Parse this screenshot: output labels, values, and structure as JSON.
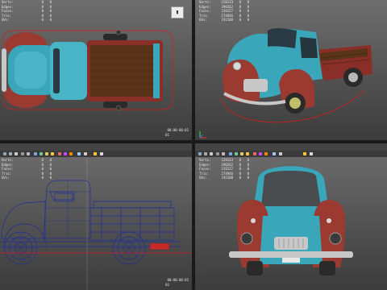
{
  "viewports": {
    "top": {
      "stats": [
        {
          "key": "Verts:",
          "value": "",
          "a": "0",
          "b": "0"
        },
        {
          "key": "Edges:",
          "value": "",
          "a": "0",
          "b": "0"
        },
        {
          "key": "Faces:",
          "value": "",
          "a": "0",
          "b": "0"
        },
        {
          "key": "Tris:",
          "value": "",
          "a": "0",
          "b": "0"
        },
        {
          "key": "UVs:",
          "value": "",
          "a": "0",
          "b": "0"
        }
      ],
      "corner_button_glyph": "▮",
      "time": "00:00:00:01",
      "frame": "01"
    },
    "perspective": {
      "stats": [
        {
          "key": "Verts:",
          "value": "158133",
          "a": "0",
          "b": "0"
        },
        {
          "key": "Edges:",
          "value": "290262",
          "a": "0",
          "b": "0"
        },
        {
          "key": "Faces:",
          "value": "150127",
          "a": "0",
          "b": "0"
        },
        {
          "key": "Tris:",
          "value": "274946",
          "a": "0",
          "b": "0"
        },
        {
          "key": "UVs:",
          "value": "192108",
          "a": "0",
          "b": "0"
        }
      ]
    },
    "side": {
      "menu": [
        "Lighting",
        "Show",
        "Renderer",
        "Panels"
      ],
      "stats": [
        {
          "key": "Verts:",
          "value": "",
          "a": "0",
          "b": "0"
        },
        {
          "key": "Edges:",
          "value": "",
          "a": "0",
          "b": "0"
        },
        {
          "key": "Faces:",
          "value": "",
          "a": "0",
          "b": "0"
        },
        {
          "key": "Tris:",
          "value": "",
          "a": "0",
          "b": "0"
        },
        {
          "key": "UVs:",
          "value": "",
          "a": "0",
          "b": "0"
        }
      ],
      "time": "00:00:00:01",
      "frame": "01"
    },
    "front": {
      "menu": [
        "View",
        "Shading",
        "Lighting",
        "Show",
        "Renderer",
        "Panels"
      ],
      "stats": [
        {
          "key": "Verts:",
          "value": "158133",
          "a": "0",
          "b": "0"
        },
        {
          "key": "Edges:",
          "value": "290262",
          "a": "0",
          "b": "0"
        },
        {
          "key": "Faces:",
          "value": "150127",
          "a": "0",
          "b": "0"
        },
        {
          "key": "Tris:",
          "value": "274946",
          "a": "0",
          "b": "0"
        },
        {
          "key": "UVs:",
          "value": "192108",
          "a": "0",
          "b": "0"
        }
      ]
    }
  },
  "colors": {
    "body_teal": "#3aa6b9",
    "fender_red": "#9b3a30",
    "wood": "#5a3418",
    "chrome": "#c8c8c8",
    "tire": "#2a2a2a",
    "wire_blue": "#1f2f9a",
    "selection_red": "#d81d1d",
    "viewport_top": "#6e6e6e",
    "viewport_bottom": "#3c3c3c"
  }
}
